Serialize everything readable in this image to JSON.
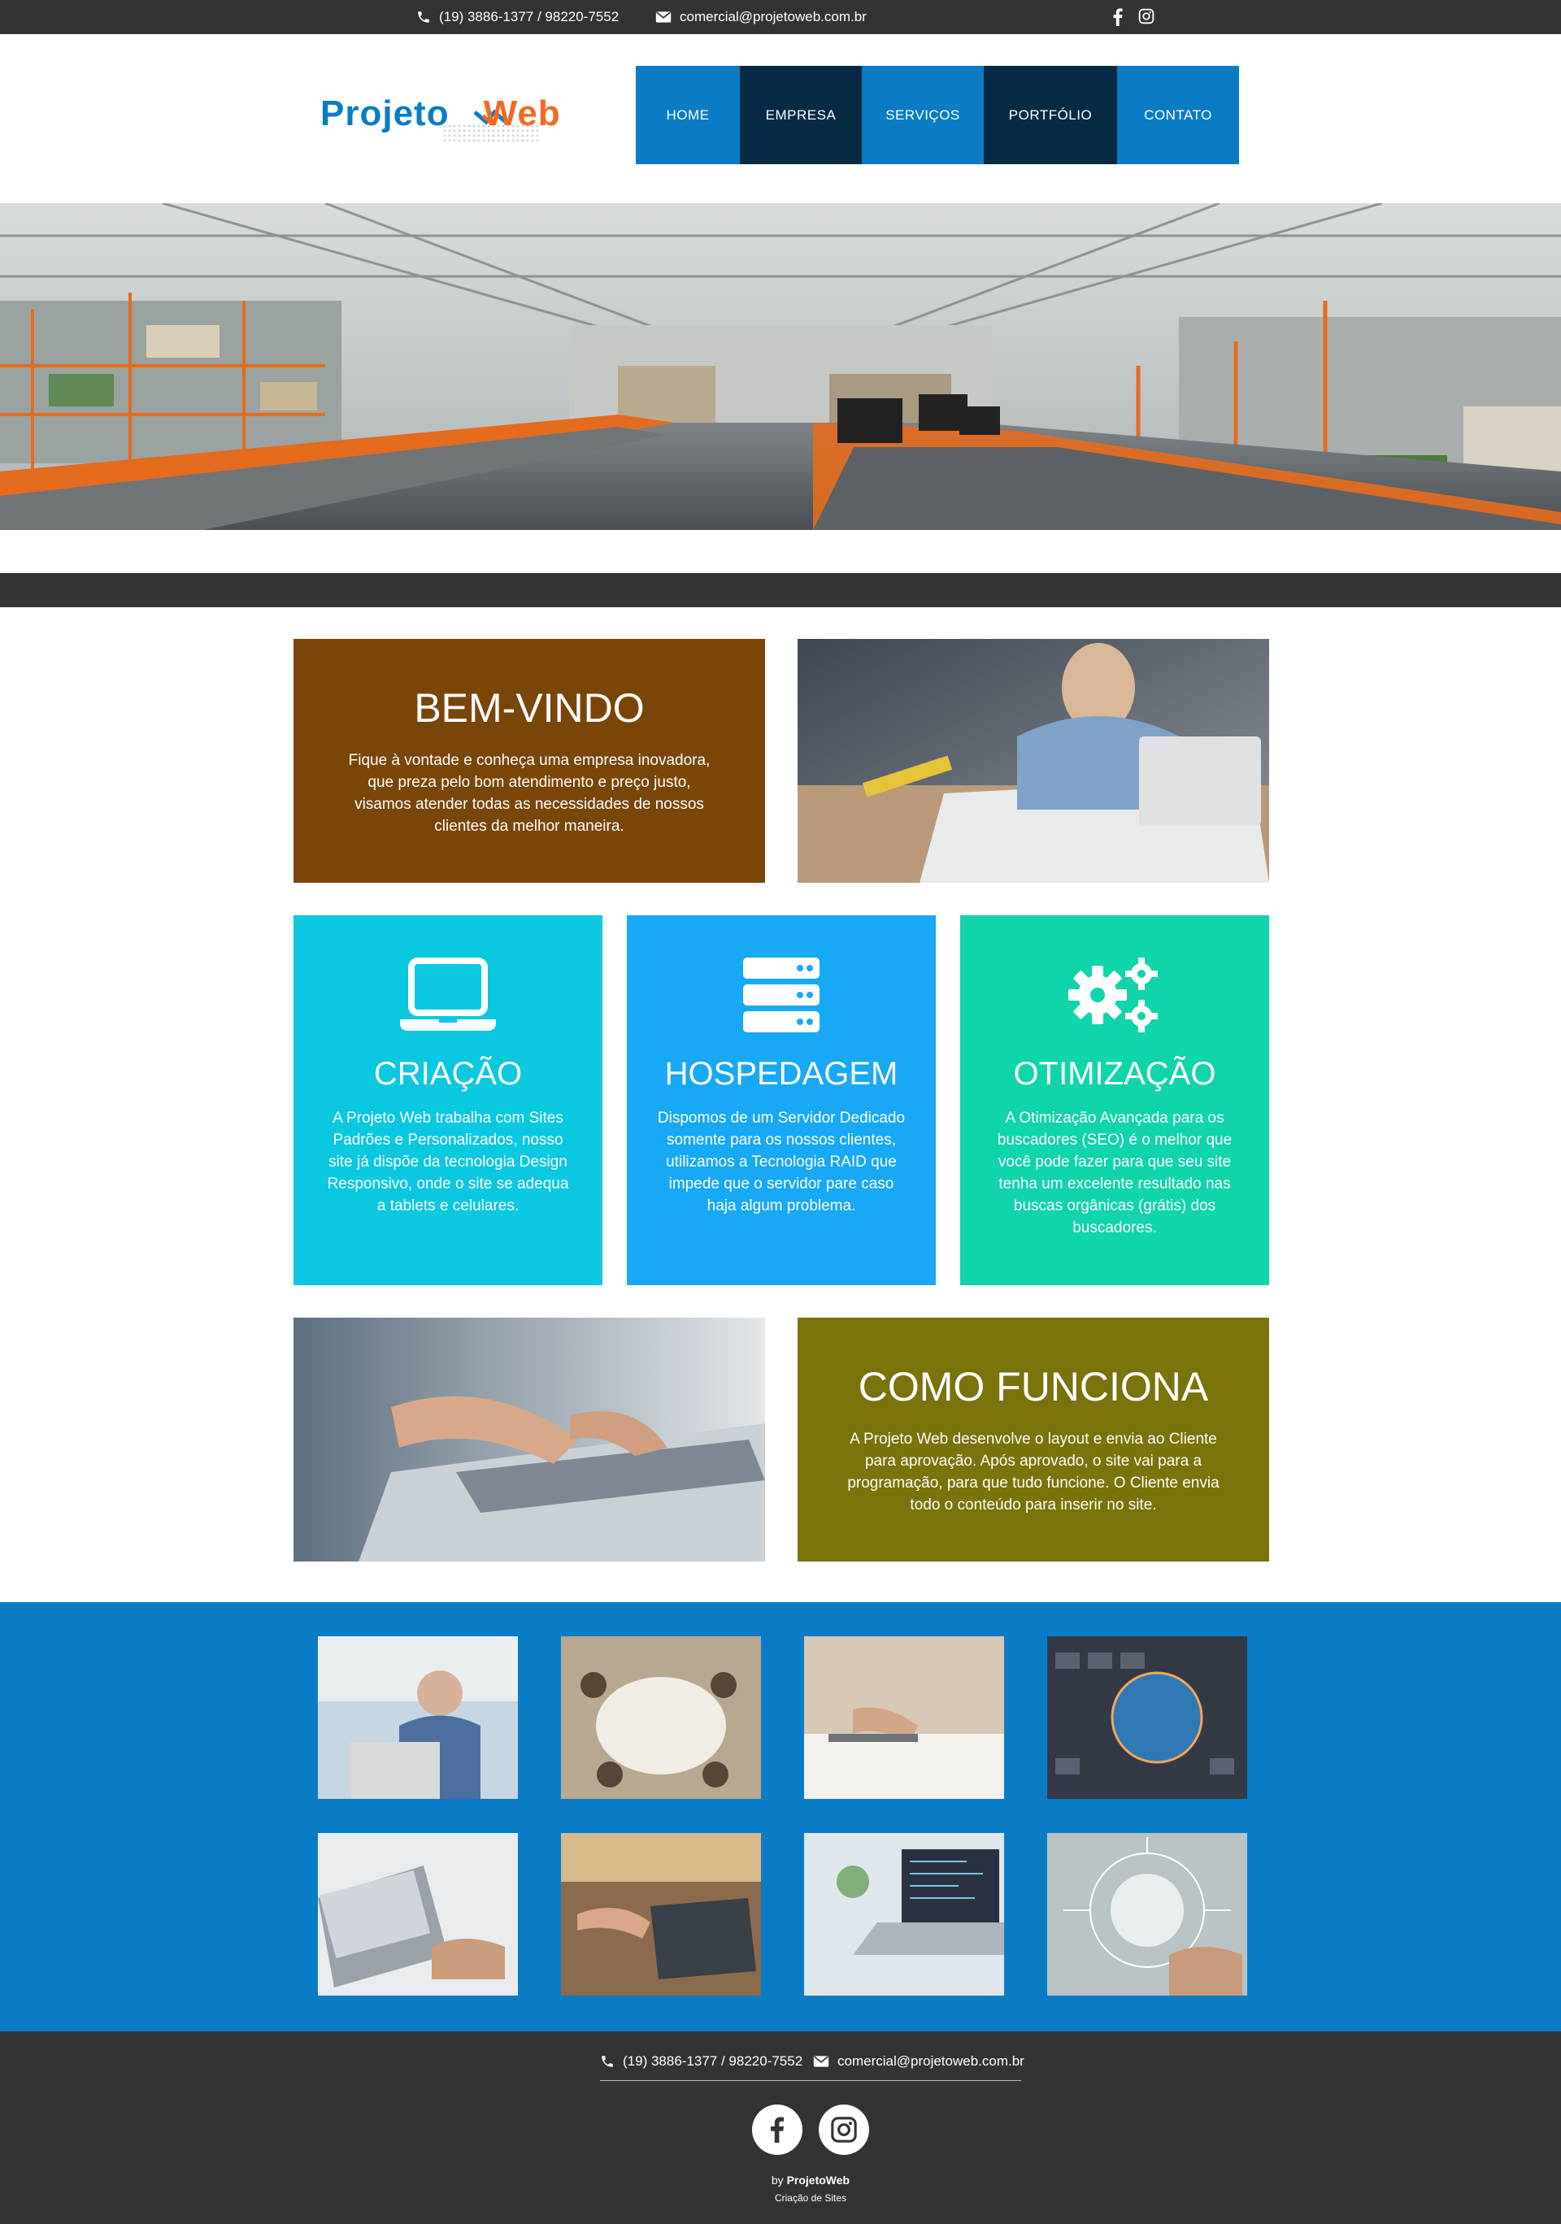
{
  "topbar": {
    "phone": "(19) 3886-1377 / 98220-7552",
    "email": "comercial@projetoweb.com.br",
    "social": [
      "facebook-icon",
      "instagram-icon"
    ]
  },
  "logo": {
    "part1": "Projeto",
    "part2": "Web",
    "color1": "#0a7cc6",
    "color2": "#f26a21"
  },
  "nav": [
    {
      "label": "HOME",
      "color": "#0a7cc6"
    },
    {
      "label": "EMPRESA",
      "color": "#062a44"
    },
    {
      "label": "SERVIÇOS",
      "color": "#0a7cc6"
    },
    {
      "label": "PORTFÓLIO",
      "color": "#062a44"
    },
    {
      "label": "CONTATO",
      "color": "#0a7cc6"
    }
  ],
  "welcome": {
    "title": "BEM-VINDO",
    "text": "Fique à vontade e conheça uma empresa inovadora, que preza pelo bom atendimento e preço justo, visamos atender todas as necessidades de nossos clientes da melhor maneira.",
    "color": "#7a4608"
  },
  "services": [
    {
      "icon": "laptop-icon",
      "title": "CRIAÇÃO",
      "text": "A Projeto Web trabalha com Sites Padrões e Personalizados, nosso site já dispõe da tecnologia Design Responsivo, onde o site se adequa a tablets e celulares.",
      "color": "#0ac8e0"
    },
    {
      "icon": "server-icon",
      "title": "HOSPEDAGEM",
      "text": "Dispomos de um Servidor Dedicado somente para os nossos clientes, utilizamos a Tecnologia RAID que impede que o servidor pare caso haja algum problema.",
      "color": "#17a9f5"
    },
    {
      "icon": "gears-icon",
      "title": "OTIMIZAÇÃO",
      "text": "A Otimização Avançada para os buscadores (SEO) é o melhor que você pode fazer para que seu site tenha um excelente resultado nas buscas orgânicas (grátis) dos buscadores.",
      "color": "#10d4ab"
    }
  ],
  "howto": {
    "title": "COMO FUNCIONA",
    "text": "A Projeto Web desenvolve o layout e envia ao Cliente para aprovação. Após aprovado, o site vai para a programação, para que tudo funcione. O Cliente envia todo o conteúdo para inserir no site.",
    "color": "#7a720a"
  },
  "gallery": {
    "color": "#0a7cc6",
    "count": 8
  },
  "footer": {
    "phone": "(19) 3886-1377 / 98220-7552",
    "email": "comercial@projetoweb.com.br",
    "credit_by": "by",
    "credit_logo": "ProjetoWeb",
    "credit_sub": "Criação de Sites"
  }
}
